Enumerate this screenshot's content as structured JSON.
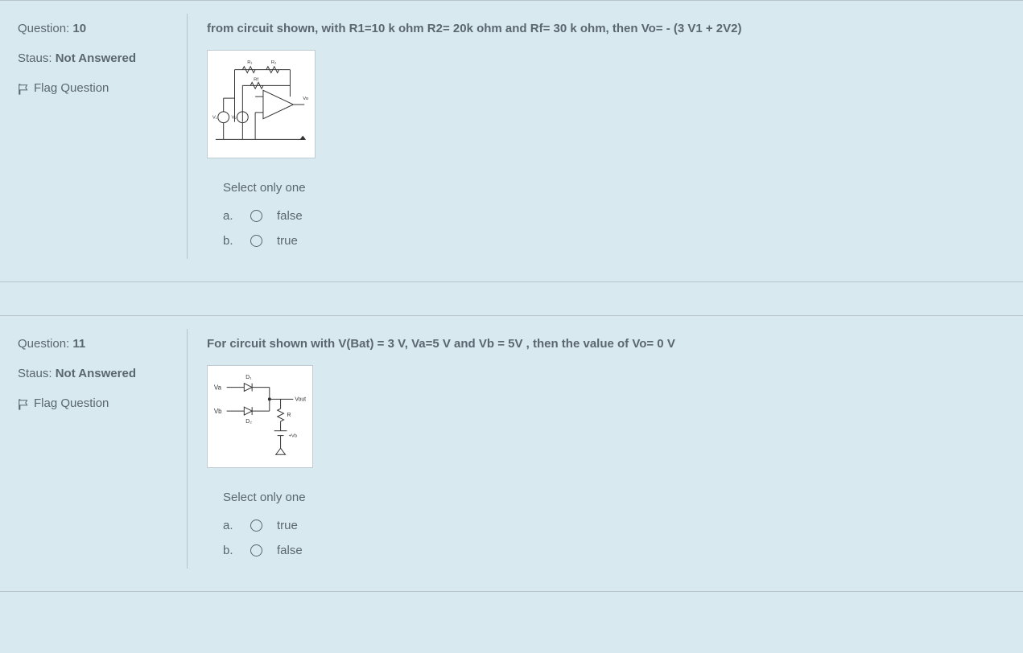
{
  "questions": [
    {
      "meta": {
        "question_label": "Question:",
        "question_number": "10",
        "status_label": "Staus:",
        "status_value": "Not Answered",
        "flag_label": "Flag Question"
      },
      "text": "from circuit shown, with R1=10 k ohm  R2= 20k ohm and Rf= 30 k ohm, then Vo= - (3 V1 + 2V2)",
      "select_label": "Select only one",
      "options": [
        {
          "letter": "a.",
          "label": "false"
        },
        {
          "letter": "b.",
          "label": "true"
        }
      ]
    },
    {
      "meta": {
        "question_label": "Question:",
        "question_number": "11",
        "status_label": "Staus:",
        "status_value": "Not Answered",
        "flag_label": "Flag Question"
      },
      "text": "For circuit shown with V(Bat) = 3 V,  Va=5 V  and Vb = 5V  , then the value of Vo= 0 V",
      "select_label": "Select only one",
      "options": [
        {
          "letter": "a.",
          "label": "true"
        },
        {
          "letter": "b.",
          "label": "false"
        }
      ]
    }
  ]
}
